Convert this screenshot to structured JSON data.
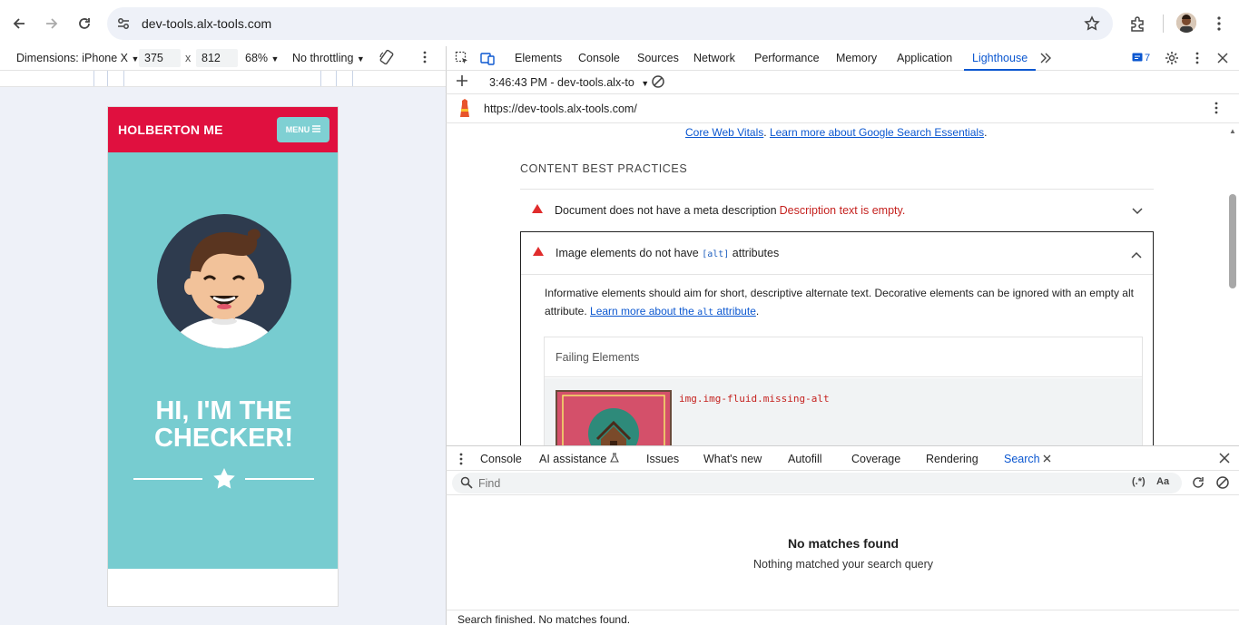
{
  "browser": {
    "url": "dev-tools.alx-tools.com",
    "icons": [
      "back-icon",
      "forward-icon",
      "reload-icon",
      "site-settings-icon",
      "bookmark-star-icon",
      "extensions-icon",
      "profile-avatar",
      "chrome-menu-icon"
    ]
  },
  "device_toolbar": {
    "device": "Dimensions: iPhone X",
    "width": "375",
    "x": "x",
    "height": "812",
    "zoom": "68%",
    "throttle": "No throttling"
  },
  "phone": {
    "brand": "HOLBERTON ME",
    "menu_label": "MENU",
    "hero_line1": "HI, I'M THE",
    "hero_line2": "CHECKER!",
    "colors": {
      "header": "#e0103f",
      "hero": "#77ccd0",
      "menu": "#7fd0d3"
    }
  },
  "devtools": {
    "tabs": [
      "Elements",
      "Console",
      "Sources",
      "Network",
      "Performance",
      "Memory",
      "Application",
      "Lighthouse"
    ],
    "active_tab": "Lighthouse",
    "issues_count": "7",
    "lighthouse": {
      "report_time": "3:46:43 PM - dev-tools.alx-to",
      "report_url": "https://dev-tools.alx-tools.com/",
      "link_core_web_vitals": "Core Web Vitals",
      "link_search_essentials": "Learn more about Google Search Essentials",
      "section_title": "CONTENT BEST PRACTICES",
      "audit1_title": "Document does not have a meta description",
      "audit1_extra": "Description text is empty.",
      "audit2_title_a": "Image elements do not have ",
      "audit2_code": "[alt]",
      "audit2_title_b": " attributes",
      "audit2_desc_a": "Informative elements should aim for short, descriptive alternate text. Decorative elements can be ignored with an empty alt attribute. ",
      "audit2_link_a": "Learn more about the ",
      "audit2_link_code": "alt",
      "audit2_link_b": " attribute",
      "failing_header": "Failing Elements",
      "failing_selector": "img.img-fluid.missing-alt"
    }
  },
  "drawer": {
    "tabs": [
      "Console",
      "AI assistance",
      "Issues",
      "What's new",
      "Autofill",
      "Coverage",
      "Rendering",
      "Search"
    ],
    "active_tab": "Search",
    "search_placeholder": "Find",
    "regex_label": "(.*)",
    "case_label": "Aa",
    "no_matches_title": "No matches found",
    "no_matches_sub": "Nothing matched your search query",
    "status": "Search finished.  No matches found."
  }
}
